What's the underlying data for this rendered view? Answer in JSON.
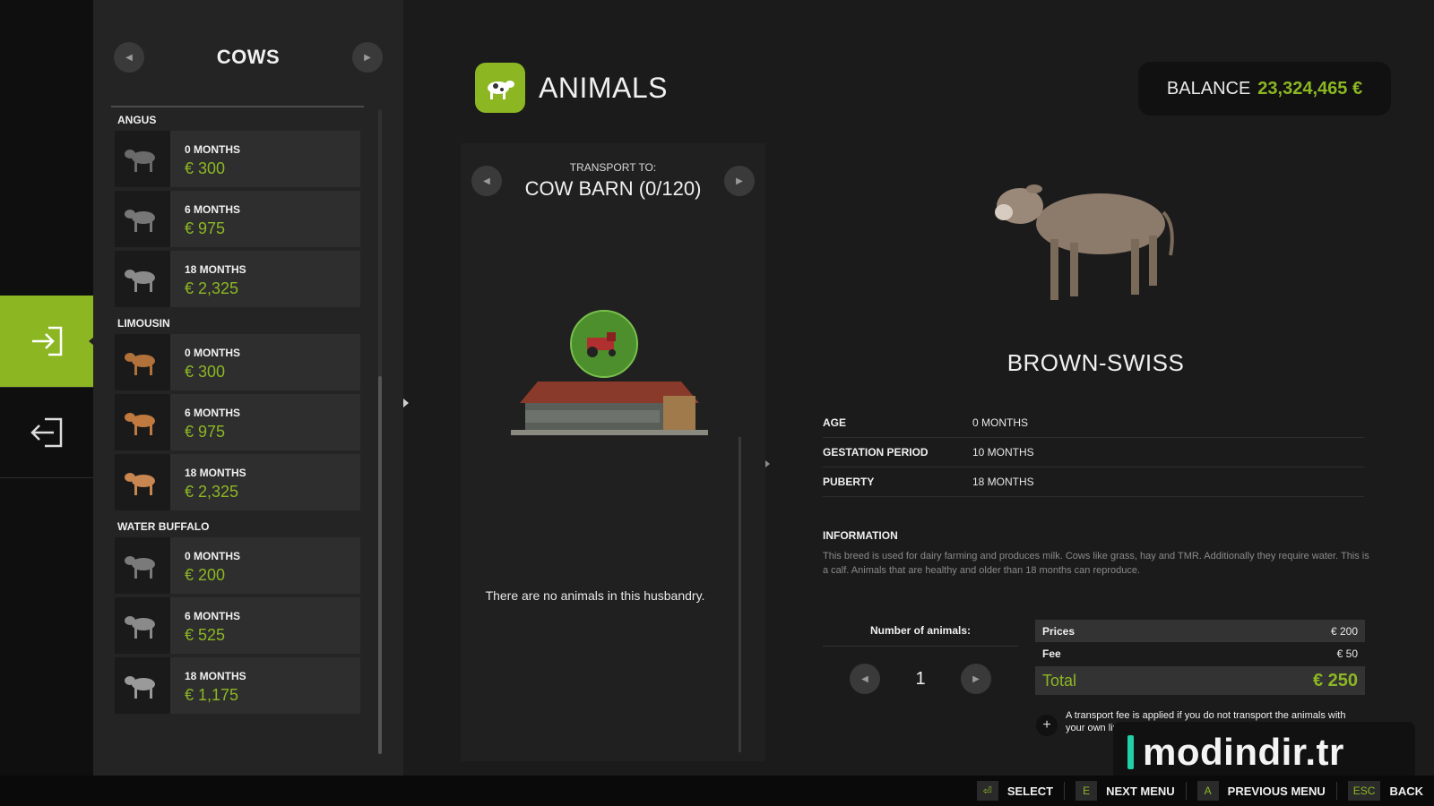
{
  "category": {
    "title": "COWS",
    "groups": [
      {
        "breed": "ANGUS",
        "items": [
          {
            "age": "0 MONTHS",
            "price": "€ 300",
            "color": "#6a6a6a"
          },
          {
            "age": "6 MONTHS",
            "price": "€ 975",
            "color": "#777777"
          },
          {
            "age": "18 MONTHS",
            "price": "€ 2,325",
            "color": "#8a8a8a"
          }
        ]
      },
      {
        "breed": "LIMOUSIN",
        "items": [
          {
            "age": "0 MONTHS",
            "price": "€ 300",
            "color": "#b0723a"
          },
          {
            "age": "6 MONTHS",
            "price": "€ 975",
            "color": "#c07a40"
          },
          {
            "age": "18 MONTHS",
            "price": "€ 2,325",
            "color": "#c88650"
          }
        ]
      },
      {
        "breed": "WATER BUFFALO",
        "items": [
          {
            "age": "0 MONTHS",
            "price": "€ 200",
            "color": "#7a7a7a"
          },
          {
            "age": "6 MONTHS",
            "price": "€ 525",
            "color": "#8a8a8a"
          },
          {
            "age": "18 MONTHS",
            "price": "€ 1,175",
            "color": "#9a9a9a"
          }
        ]
      }
    ]
  },
  "header": {
    "title": "ANIMALS",
    "icon": "cow-icon"
  },
  "balance": {
    "label": "BALANCE",
    "value": "23,324,465 €"
  },
  "transport": {
    "label": "TRANSPORT TO:",
    "destination": "COW BARN (0/120)",
    "empty_message": "There are no animals in this husbandry."
  },
  "detail": {
    "name": "BROWN-SWISS",
    "stats": [
      {
        "key": "AGE",
        "value": "0 MONTHS"
      },
      {
        "key": "GESTATION PERIOD",
        "value": "10 MONTHS"
      },
      {
        "key": "PUBERTY",
        "value": "18 MONTHS"
      }
    ],
    "info_title": "INFORMATION",
    "info_text": "This breed is used for dairy farming and produces milk. Cows like grass, hay and TMR. Additionally they require water. This is a calf. Animals that are healthy and older than 18 months can reproduce."
  },
  "quantity": {
    "label": "Number of animals:",
    "value": "1"
  },
  "pricing": {
    "prices_label": "Prices",
    "prices_value": "€ 200",
    "fee_label": "Fee",
    "fee_value": "€ 50",
    "total_label": "Total",
    "total_value": "€ 250",
    "note": "A transport fee is applied if you do not transport the animals with your own livestock trailer!"
  },
  "watermark": {
    "text": "modindir.tr"
  },
  "footer": [
    {
      "key": "⏎",
      "label": "SELECT"
    },
    {
      "key": "E",
      "label": "NEXT MENU"
    },
    {
      "key": "A",
      "label": "PREVIOUS MENU"
    },
    {
      "key": "ESC",
      "label": "BACK"
    }
  ],
  "colors": {
    "accent": "#8cb723",
    "background": "#1b1b1b"
  }
}
